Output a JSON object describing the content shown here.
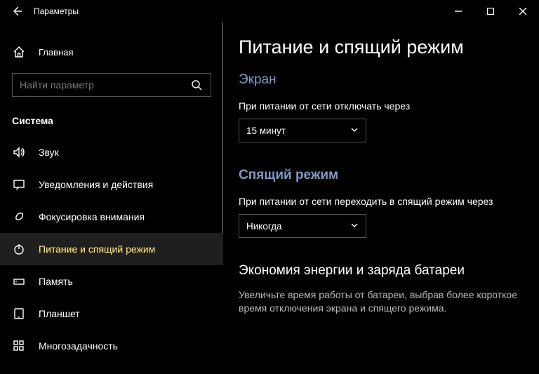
{
  "window": {
    "title": "Параметры"
  },
  "sidebar": {
    "home_label": "Главная",
    "search_placeholder": "Найти параметр",
    "category": "Система",
    "items": [
      {
        "label": "Звук"
      },
      {
        "label": "Уведомления и действия"
      },
      {
        "label": "Фокусировка внимания"
      },
      {
        "label": "Питание и спящий режим"
      },
      {
        "label": "Память"
      },
      {
        "label": "Планшет"
      },
      {
        "label": "Многозадачность"
      }
    ]
  },
  "content": {
    "title": "Питание и спящий режим",
    "screen_section": "Экран",
    "screen_label": "При питании от сети отключать через",
    "screen_value": "15 минут",
    "sleep_section": "Спящий режим",
    "sleep_label": "При питании от сети переходить в спящий режим через",
    "sleep_value": "Никогда",
    "energy_section": "Экономия энергии и заряда батареи",
    "energy_text": "Увеличьте время работы от батареи, выбрав более короткое время отключения экрана и спящего режима."
  }
}
